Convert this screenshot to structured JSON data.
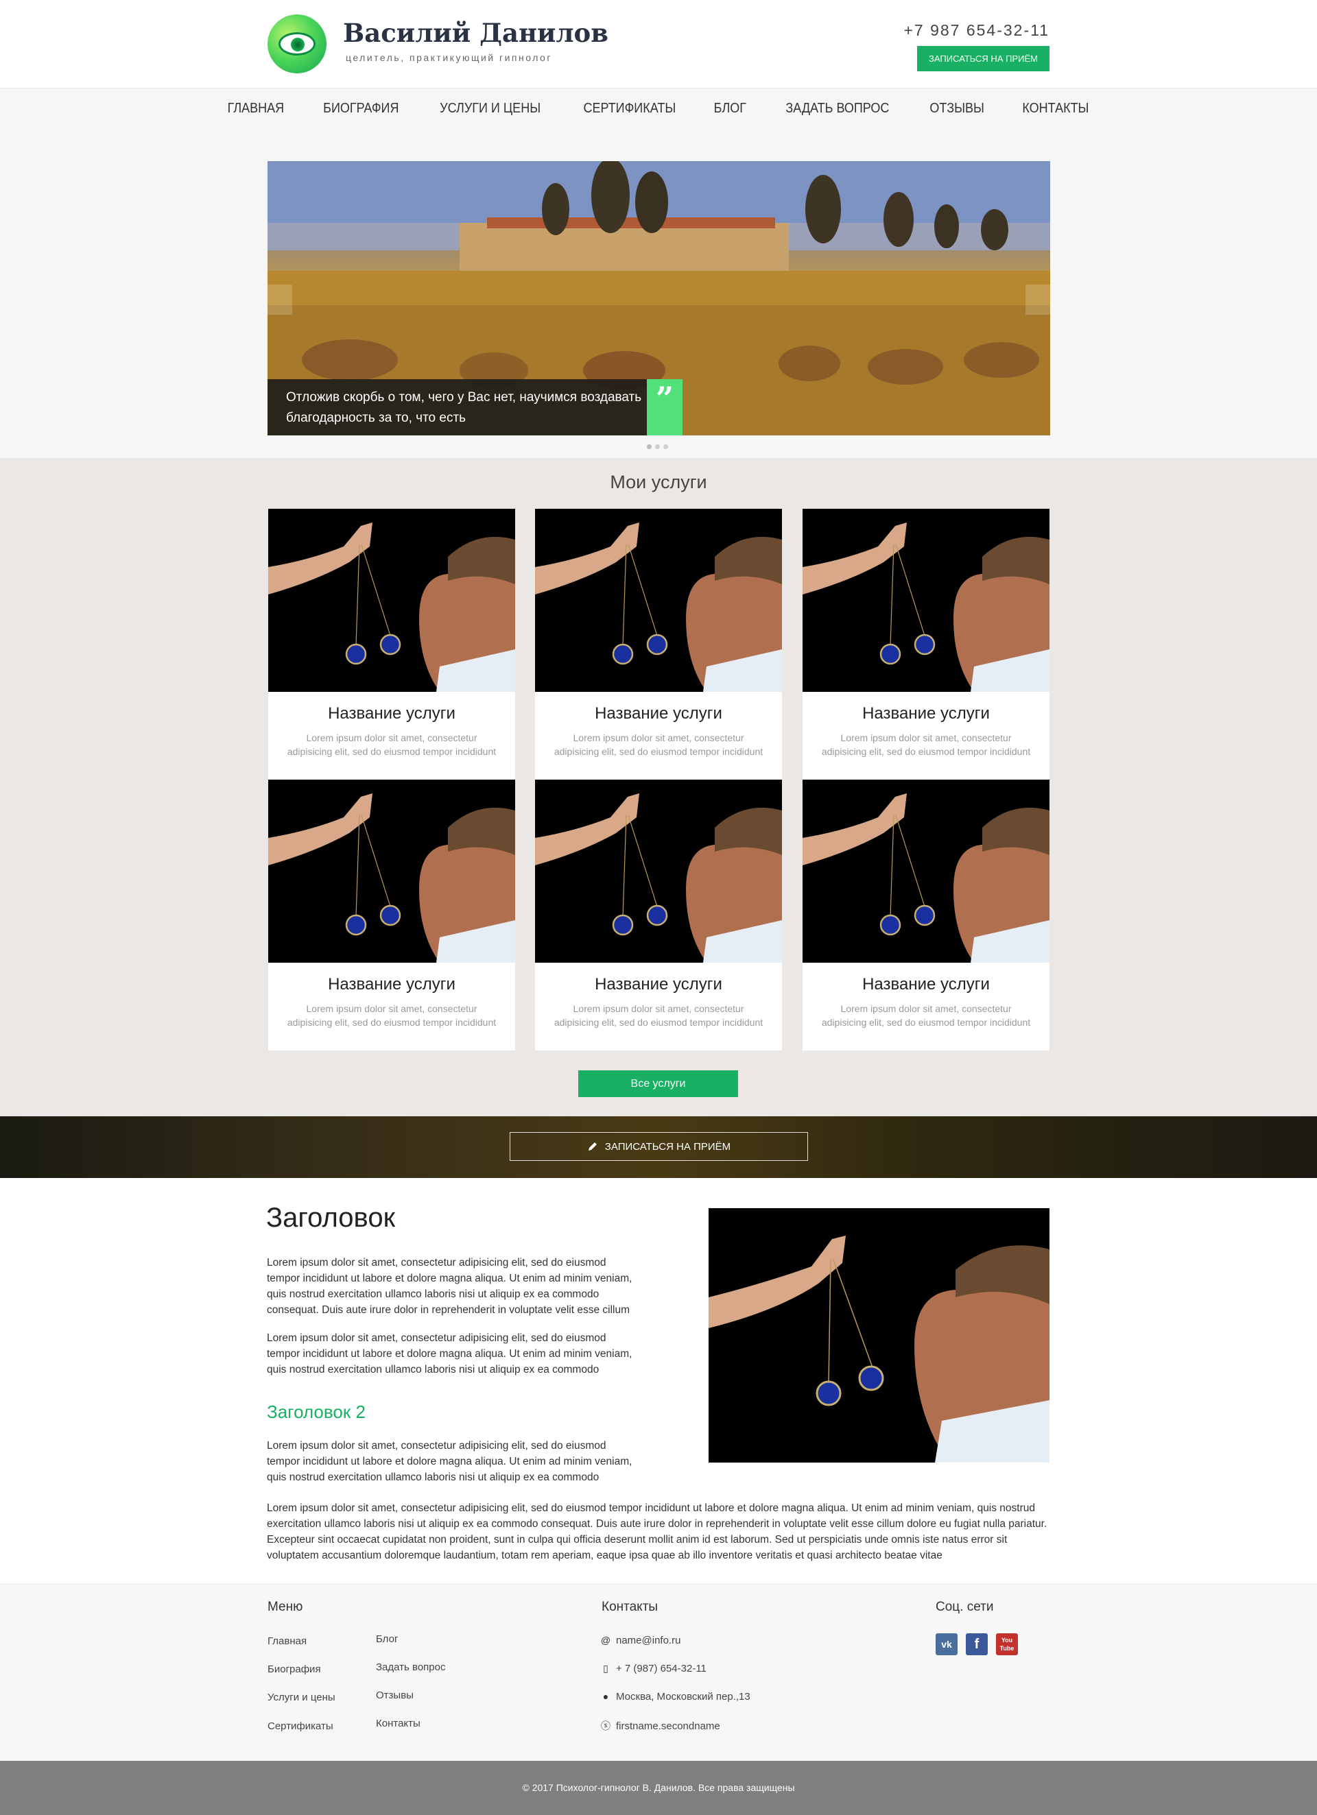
{
  "header": {
    "name": "Василий Данилов",
    "subtitle": "целитель, практикующий гипнолог",
    "phone": "+7 987 654-32-11",
    "book_button": "ЗАПИСАТЬСЯ НА ПРИЁМ"
  },
  "nav": {
    "items": [
      "ГЛАВНАЯ",
      "БИОГРАФИЯ",
      "УСЛУГИ И ЦЕНЫ",
      "СЕРТИФИКАТЫ",
      "БЛОГ",
      "ЗАДАТЬ ВОПРОС",
      "ОТЗЫВЫ",
      "КОНТАКТЫ"
    ]
  },
  "slider": {
    "caption": "Отложив скорбь о том, чего у Вас нет, научимся воздавать благодарность за то, что есть",
    "quote_mark": "”",
    "slide_count": 3,
    "active_slide": 1
  },
  "services": {
    "title": "Мои услуги",
    "cards": [
      {
        "title": "Название услуги",
        "text": "Lorem ipsum dolor sit amet, consectetur adipisicing elit, sed do eiusmod tempor incididunt"
      },
      {
        "title": "Название услуги",
        "text": "Lorem ipsum dolor sit amet, consectetur adipisicing elit, sed do eiusmod tempor incididunt"
      },
      {
        "title": "Название услуги",
        "text": "Lorem ipsum dolor sit amet, consectetur adipisicing elit, sed do eiusmod tempor incididunt"
      },
      {
        "title": "Название услуги",
        "text": "Lorem ipsum dolor sit amet, consectetur adipisicing elit, sed do eiusmod tempor incididunt"
      },
      {
        "title": "Название услуги",
        "text": "Lorem ipsum dolor sit amet, consectetur adipisicing elit, sed do eiusmod tempor incididunt"
      },
      {
        "title": "Название услуги",
        "text": "Lorem ipsum dolor sit amet, consectetur adipisicing elit, sed do eiusmod tempor incididunt"
      }
    ],
    "all_button": "Все услуги"
  },
  "banner": {
    "book_button": "ЗАПИСАТЬСЯ НА ПРИЁМ"
  },
  "article": {
    "heading": "Заголовок",
    "p1": "Lorem ipsum dolor sit amet, consectetur adipisicing elit, sed do eiusmod tempor incididunt ut labore et dolore magna aliqua. Ut enim ad minim veniam, quis nostrud exercitation ullamco laboris nisi ut aliquip ex ea commodo consequat. Duis aute irure dolor in reprehenderit in voluptate velit esse cillum",
    "p2": "Lorem ipsum dolor sit amet, consectetur adipisicing elit, sed do eiusmod tempor incididunt ut labore et dolore magna aliqua. Ut enim ad minim veniam, quis nostrud exercitation ullamco laboris nisi ut aliquip ex ea commodo",
    "heading2": "Заголовок 2",
    "p3": "Lorem ipsum dolor sit amet, consectetur adipisicing elit, sed do eiusmod tempor incididunt ut labore et dolore magna aliqua. Ut enim ad minim veniam, quis nostrud exercitation ullamco laboris nisi ut aliquip ex ea commodo",
    "p4": "Lorem ipsum dolor sit amet, consectetur adipisicing elit, sed do eiusmod tempor incididunt ut labore et dolore magna aliqua. Ut enim ad minim veniam, quis nostrud exercitation ullamco laboris nisi ut aliquip ex ea commodo consequat. Duis aute irure dolor in reprehenderit in voluptate velit esse cillum dolore eu fugiat nulla pariatur. Excepteur sint occaecat cupidatat non proident, sunt in culpa qui officia deserunt mollit anim id est laborum. Sed ut perspiciatis unde omnis iste natus error sit voluptatem accusantium doloremque laudantium, totam rem aperiam, eaque ipsa quae ab illo inventore veritatis et quasi architecto beatae vitae"
  },
  "footer": {
    "menu_title": "Меню",
    "menu_col1": [
      "Главная",
      "Биография",
      "Услуги и цены",
      "Сертификаты"
    ],
    "menu_col2": [
      "Блог",
      "Задать вопрос",
      "Отзывы",
      "Контакты"
    ],
    "contacts_title": "Контакты",
    "email": "name@info.ru",
    "phone": "+ 7 (987) 654-32-11",
    "address": "Москва, Московский  пер.,13",
    "skype": "firstname.secondname",
    "social_title": "Соц. сети",
    "social": {
      "vk": "vk",
      "fb": "f",
      "yt": "You Tube"
    }
  },
  "copyright": "© 2017 Психолог-гипнолог В. Данилов. Все права защищены",
  "colors": {
    "accent": "#19b064",
    "quote": "#51e07a",
    "footer_bottom": "#7f7f7f"
  }
}
